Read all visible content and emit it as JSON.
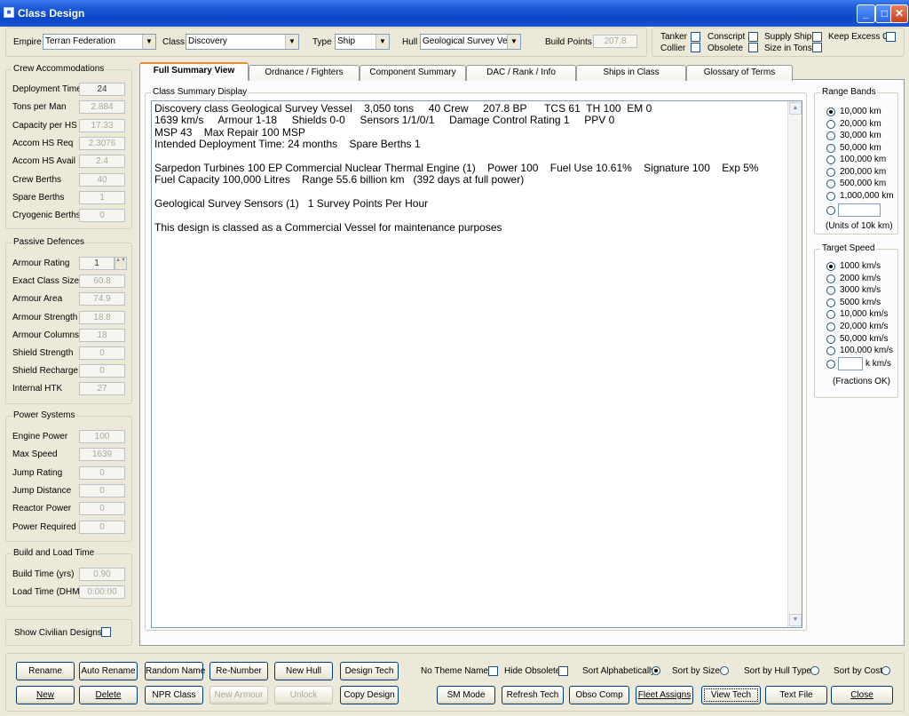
{
  "window": {
    "title": "Class Design"
  },
  "top": {
    "empire_label": "Empire",
    "empire_value": "Terran Federation",
    "class_label": "Class",
    "class_value": "Discovery",
    "type_label": "Type",
    "type_value": "Ship",
    "hull_label": "Hull",
    "hull_value": "Geological Survey Vess",
    "build_points_label": "Build Points",
    "build_points_value": "207.8",
    "checks": [
      "Tanker",
      "Collier",
      "Conscript",
      "Obsolete",
      "Supply Ship",
      "Size in Tons",
      "Keep Excess Q"
    ]
  },
  "crew": {
    "title": "Crew Accommodations",
    "rows": [
      {
        "label": "Deployment Time",
        "value": "24"
      },
      {
        "label": "Tons per Man",
        "value": "2.884"
      },
      {
        "label": "Capacity per HS",
        "value": "17.33"
      },
      {
        "label": "Accom HS Req",
        "value": "2.3076"
      },
      {
        "label": "Accom HS Avail",
        "value": "2.4"
      },
      {
        "label": "Crew Berths",
        "value": "40"
      },
      {
        "label": "Spare Berths",
        "value": "1"
      },
      {
        "label": "Cryogenic Berths",
        "value": "0"
      }
    ]
  },
  "passive": {
    "title": "Passive Defences",
    "rows": [
      {
        "label": "Armour Rating",
        "value": "1"
      },
      {
        "label": "Exact Class Size",
        "value": "60.8"
      },
      {
        "label": "Armour Area",
        "value": "74.9"
      },
      {
        "label": "Armour Strength",
        "value": "18.8"
      },
      {
        "label": "Armour Columns",
        "value": "18"
      },
      {
        "label": "Shield Strength",
        "value": "0"
      },
      {
        "label": "Shield Recharge",
        "value": "0"
      },
      {
        "label": "Internal HTK",
        "value": "27"
      }
    ]
  },
  "power": {
    "title": "Power Systems",
    "rows": [
      {
        "label": "Engine Power",
        "value": "100"
      },
      {
        "label": "Max Speed",
        "value": "1639"
      },
      {
        "label": "Jump Rating",
        "value": "0"
      },
      {
        "label": "Jump Distance",
        "value": "0"
      },
      {
        "label": "Reactor Power",
        "value": "0"
      },
      {
        "label": "Power Required",
        "value": "0"
      }
    ]
  },
  "build": {
    "title": "Build and Load Time",
    "rows": [
      {
        "label": "Build Time (yrs)",
        "value": "0.90"
      },
      {
        "label": "Load Time (DHM)",
        "value": "0:00:00"
      }
    ]
  },
  "show_civilian_label": "Show Civilian Designs",
  "tabs": [
    "Full Summary View",
    "Ordnance / Fighters",
    "Component Summary",
    "DAC / Rank / Info",
    "Ships in Class",
    "Glossary of Terms"
  ],
  "summary": {
    "title": "Class Summary Display",
    "lines": [
      "Discovery class Geological Survey Vessel    3,050 tons     40 Crew     207.8 BP      TCS 61  TH 100  EM 0",
      "1639 km/s     Armour 1-18     Shields 0-0     Sensors 1/1/0/1     Damage Control Rating 1     PPV 0",
      "MSP 43    Max Repair 100 MSP",
      "Intended Deployment Time: 24 months    Spare Berths 1",
      "",
      "Sarpedon Turbines 100 EP Commercial Nuclear Thermal Engine (1)    Power 100    Fuel Use 10.61%    Signature 100    Exp 5%",
      "Fuel Capacity 100,000 Litres    Range 55.6 billion km   (392 days at full power)",
      "",
      "Geological Survey Sensors (1)   1 Survey Points Per Hour",
      "",
      "This design is classed as a Commercial Vessel for maintenance purposes"
    ]
  },
  "range_bands": {
    "title": "Range Bands",
    "options": [
      "10,000 km",
      "20,000 km",
      "30,000 km",
      "50,000 km",
      "100,000 km",
      "200,000 km",
      "500,000 km",
      "1,000,000 km"
    ],
    "selected": "10,000 km",
    "units_note": "(Units of 10k km)"
  },
  "target_speed": {
    "title": "Target Speed",
    "options": [
      "1000 km/s",
      "2000 km/s",
      "3000 km/s",
      "5000 km/s",
      "10,000 km/s",
      "20,000 km/s",
      "50,000 km/s",
      "100,000 km/s"
    ],
    "selected": "1000 km/s",
    "custom_suffix": "k km/s",
    "note": "(Fractions OK)"
  },
  "buttons_row1": [
    "Rename",
    "Auto Rename",
    "Random Name",
    "Re-Number",
    "New Hull",
    "Design Tech"
  ],
  "buttons_row2": [
    "New",
    "Delete",
    "NPR Class",
    "New Armour",
    "Unlock",
    "Copy Design",
    "SM Mode",
    "Refresh Tech",
    "Obso Comp",
    "Fleet Assigns",
    "View Tech",
    "Text File",
    "Close"
  ],
  "options_row": [
    "No Theme Name",
    "Hide Obsolete",
    "Sort Alphabetically",
    "Sort by Size",
    "Sort by Hull Type",
    "Sort by Cost"
  ],
  "sort_selected": "Sort Alphabetically"
}
